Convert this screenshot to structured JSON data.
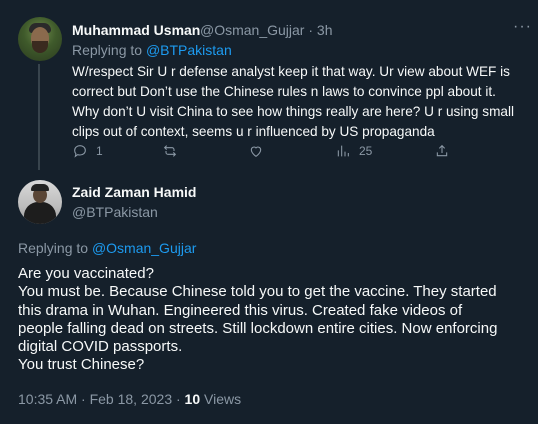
{
  "reply": {
    "author_name": "Muhammad Usman",
    "author_handle": "@Osman_Gujjar",
    "separator": "·",
    "time": "3h",
    "replying_prefix": "Replying to",
    "replying_handle": "@BTPakistan",
    "text_lines": [
      "W/respect Sir U r defense analyst keep it that way. Ur view about WEF is",
      "correct but Don’t use the Chinese rules n laws to convince ppl about it.",
      "Why don’t U visit China to see how things really are here? U r using small",
      "clips out of context, seems u r influenced by US propaganda"
    ],
    "reply_count": "1",
    "views_count": "25",
    "more_label": "···"
  },
  "main": {
    "author_name": "Zaid Zaman Hamid",
    "author_handle": "@BTPakistan",
    "replying_prefix": "Replying to",
    "replying_handle": "@Osman_Gujjar",
    "text_lines": [
      "Are you vaccinated?",
      "You must be. Because Chinese told you to get the vaccine. They started",
      "this drama in Wuhan. Engineered this virus. Created fake videos of",
      "people falling dead on streets. Still lockdown entire cities. Now enforcing",
      "digital COVID passports.",
      "You trust Chinese?"
    ],
    "timestamp": "10:35 AM · Feb 18, 2023 ·",
    "views_count": "10",
    "views_label": "Views"
  },
  "colors": {
    "background": "#15202b",
    "text": "#f7f9f9",
    "muted": "#8b98a5",
    "link": "#1d9bf0"
  }
}
